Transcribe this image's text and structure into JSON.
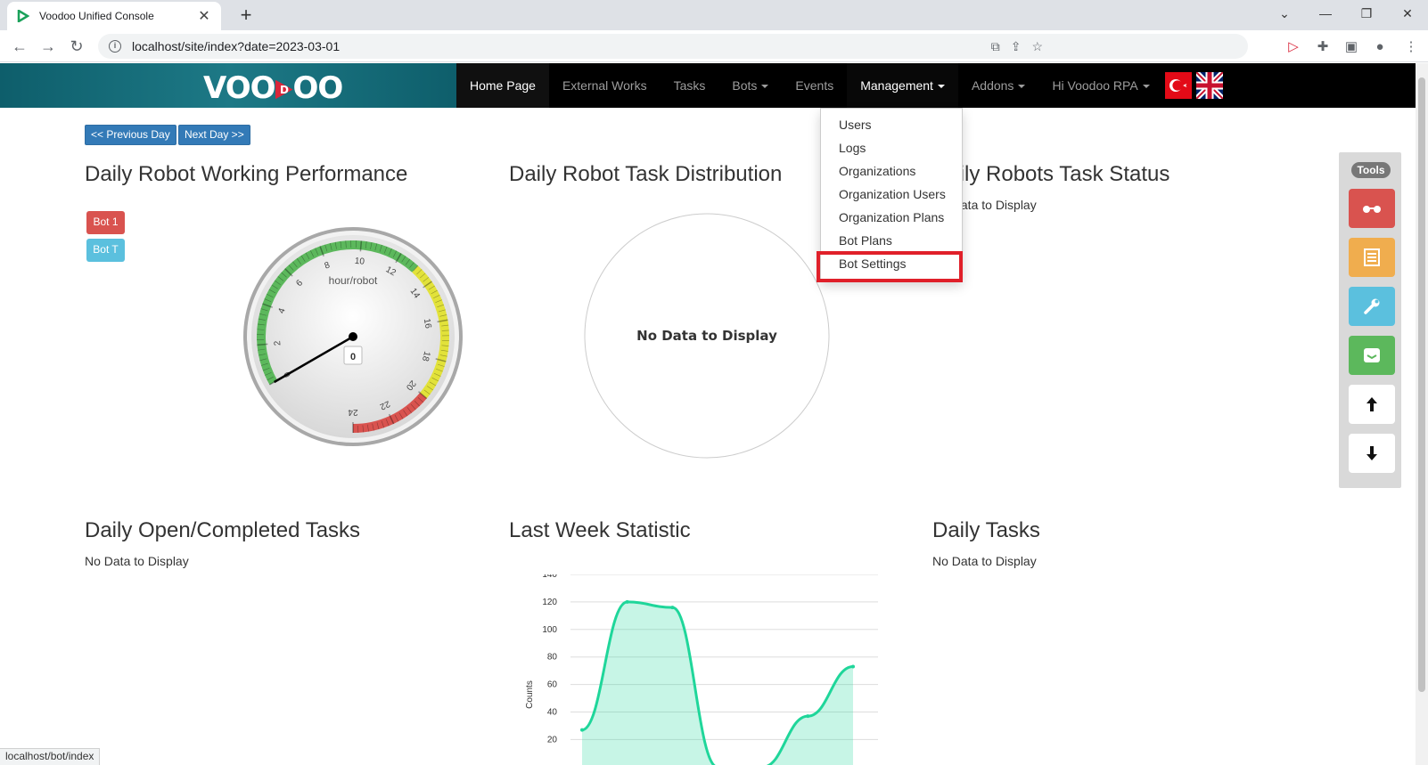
{
  "browser": {
    "tab_title": "Voodoo Unified Console",
    "url": "localhost/site/index?date=2023-03-01",
    "status_url": "localhost/bot/index"
  },
  "navbar": {
    "logo_left": "VOO",
    "logo_mid": "D",
    "logo_right": "OO",
    "items": [
      "Home Page",
      "External Works",
      "Tasks",
      "Bots",
      "Events",
      "Management",
      "Addons",
      "Hi Voodoo RPA"
    ]
  },
  "dropdown": {
    "items": [
      "Users",
      "Logs",
      "Organizations",
      "Organization Users",
      "Organization Plans",
      "Bot Plans",
      "Bot Settings"
    ]
  },
  "nav_buttons": {
    "prev": "<< Previous Day",
    "next": "Next Day >>"
  },
  "sections": {
    "performance": "Daily Robot Working Performance",
    "distribution": "Daily Robot Task Distribution",
    "status": "Daily Robots Task Status",
    "open_completed": "Daily Open/Completed Tasks",
    "last_week": "Last Week Statistic",
    "daily_tasks": "Daily Tasks"
  },
  "bots": [
    "Bot 1",
    "Bot T"
  ],
  "gauge": {
    "unit": "hour/robot",
    "value": "0",
    "ticks": [
      "0",
      "2",
      "4",
      "6",
      "8",
      "10",
      "12",
      "14",
      "16",
      "18",
      "20",
      "22",
      "24"
    ]
  },
  "no_data": "No Data to Display",
  "tools": {
    "label": "Tools"
  },
  "chart_data": {
    "type": "area",
    "title": "",
    "xlabel": "",
    "ylabel": "Counts",
    "y_ticks": [
      20,
      40,
      60,
      80,
      100,
      120,
      140
    ],
    "ylim": [
      0,
      140
    ],
    "x": [
      0,
      1,
      2,
      3,
      4,
      5,
      6
    ],
    "values": [
      27,
      120,
      116,
      0,
      0,
      37,
      73
    ],
    "color": "#1fd69a"
  }
}
